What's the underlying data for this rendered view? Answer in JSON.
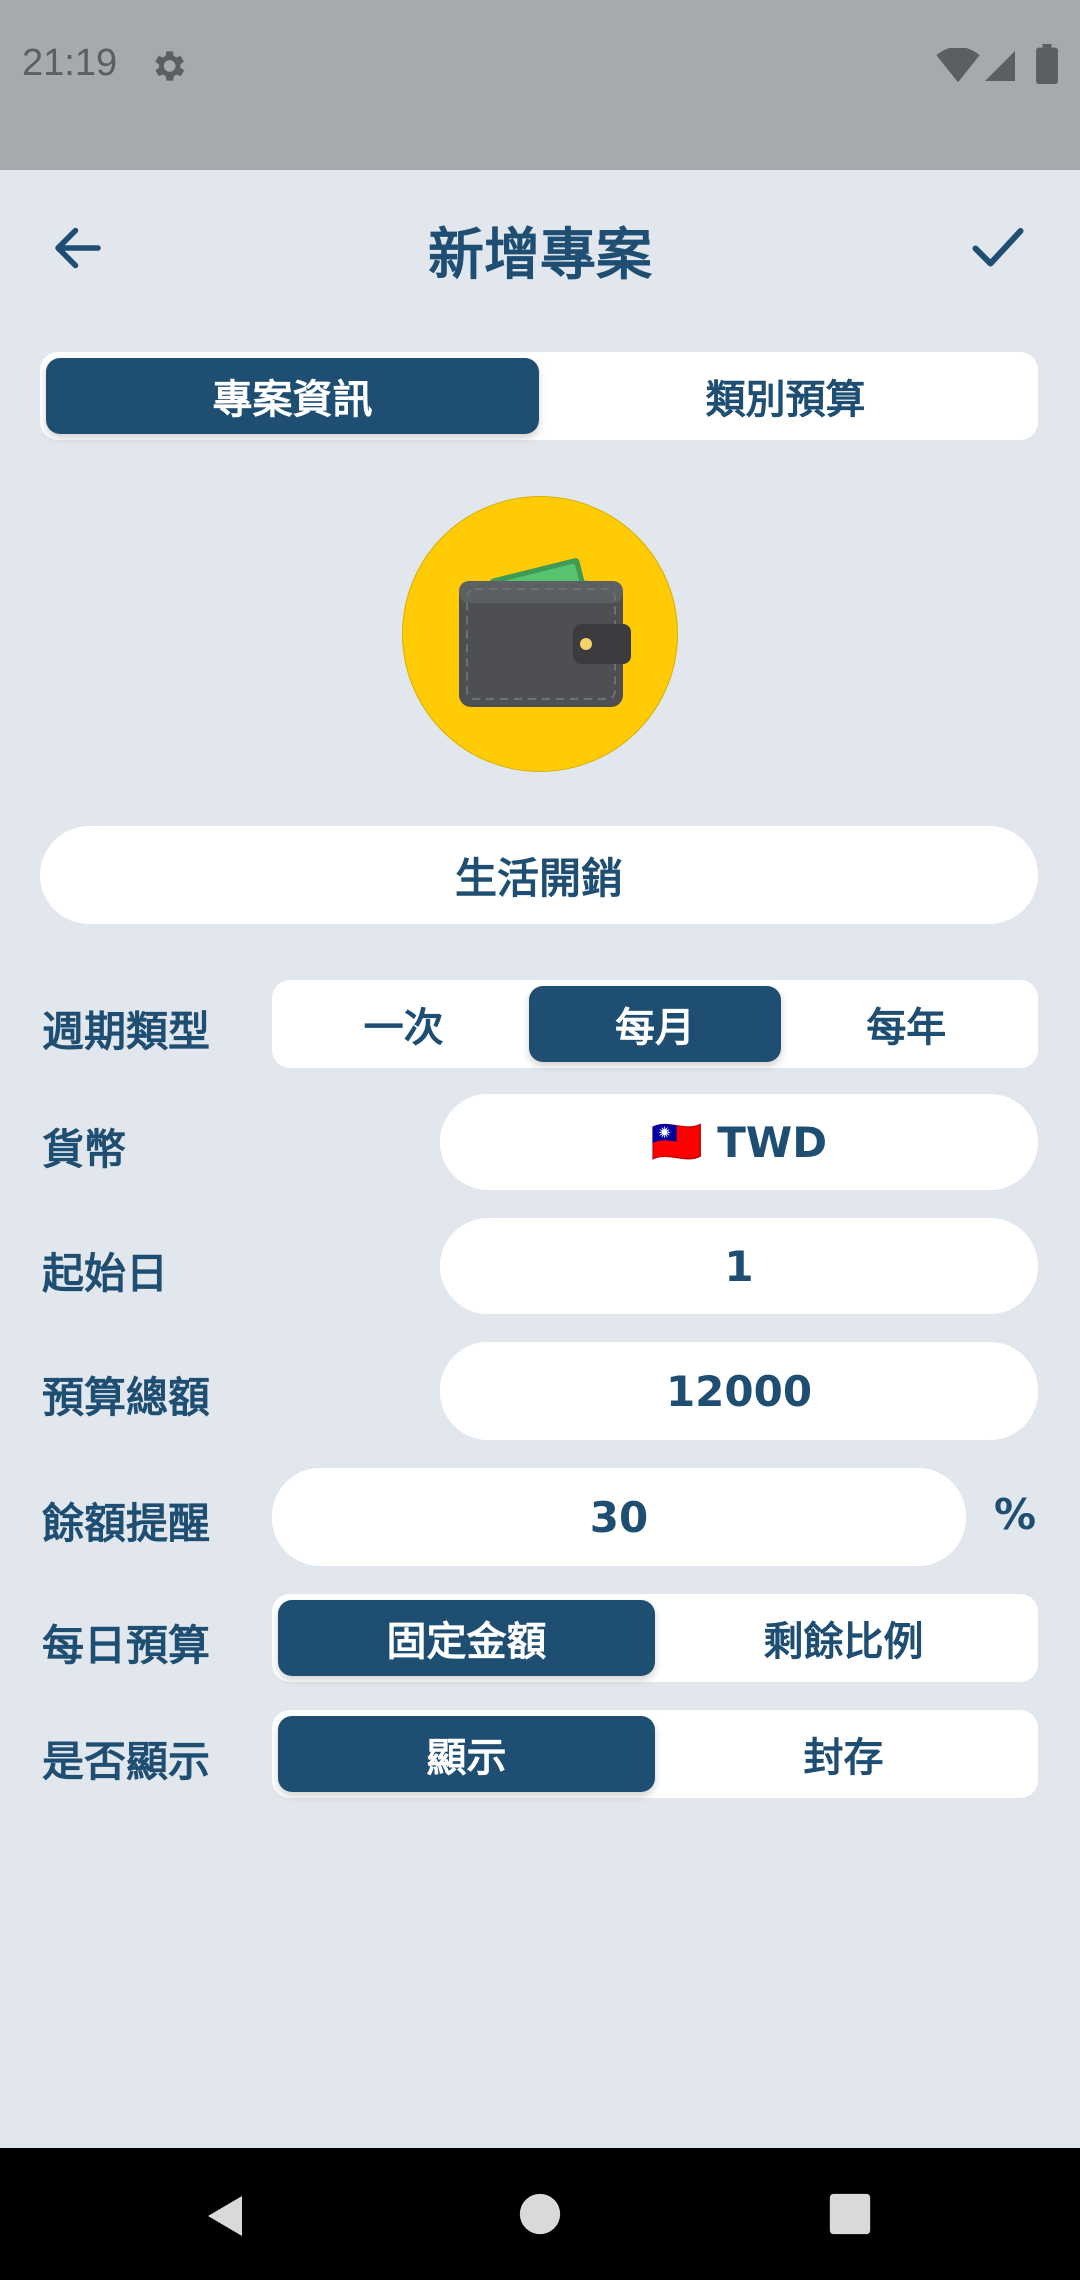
{
  "status": {
    "time": "21:19"
  },
  "header": {
    "title": "新增專案"
  },
  "tabs": [
    {
      "label": "專案資訊",
      "active": true
    },
    {
      "label": "類別預算",
      "active": false
    }
  ],
  "project": {
    "icon": "wallet-icon",
    "icon_bg": "#ffcb05",
    "name": "生活開銷"
  },
  "form": {
    "cycle": {
      "label": "週期類型",
      "options": [
        {
          "label": "一次",
          "active": false
        },
        {
          "label": "每月",
          "active": true
        },
        {
          "label": "每年",
          "active": false
        }
      ]
    },
    "currency": {
      "label": "貨幣",
      "flag": "🇹🇼",
      "value": "TWD"
    },
    "start_day": {
      "label": "起始日",
      "value": "1"
    },
    "budget_total": {
      "label": "預算總額",
      "value": "12000"
    },
    "balance_alert": {
      "label": "餘額提醒",
      "value": "30",
      "unit": "%"
    },
    "daily_budget": {
      "label": "每日預算",
      "options": [
        {
          "label": "固定金額",
          "active": true
        },
        {
          "label": "剩餘比例",
          "active": false
        }
      ]
    },
    "visibility": {
      "label": "是否顯示",
      "options": [
        {
          "label": "顯示",
          "active": true
        },
        {
          "label": "封存",
          "active": false
        }
      ]
    }
  },
  "colors": {
    "primary": "#1f4e73",
    "background": "#e2e7ee",
    "status_bar": "#a6a9ad"
  }
}
